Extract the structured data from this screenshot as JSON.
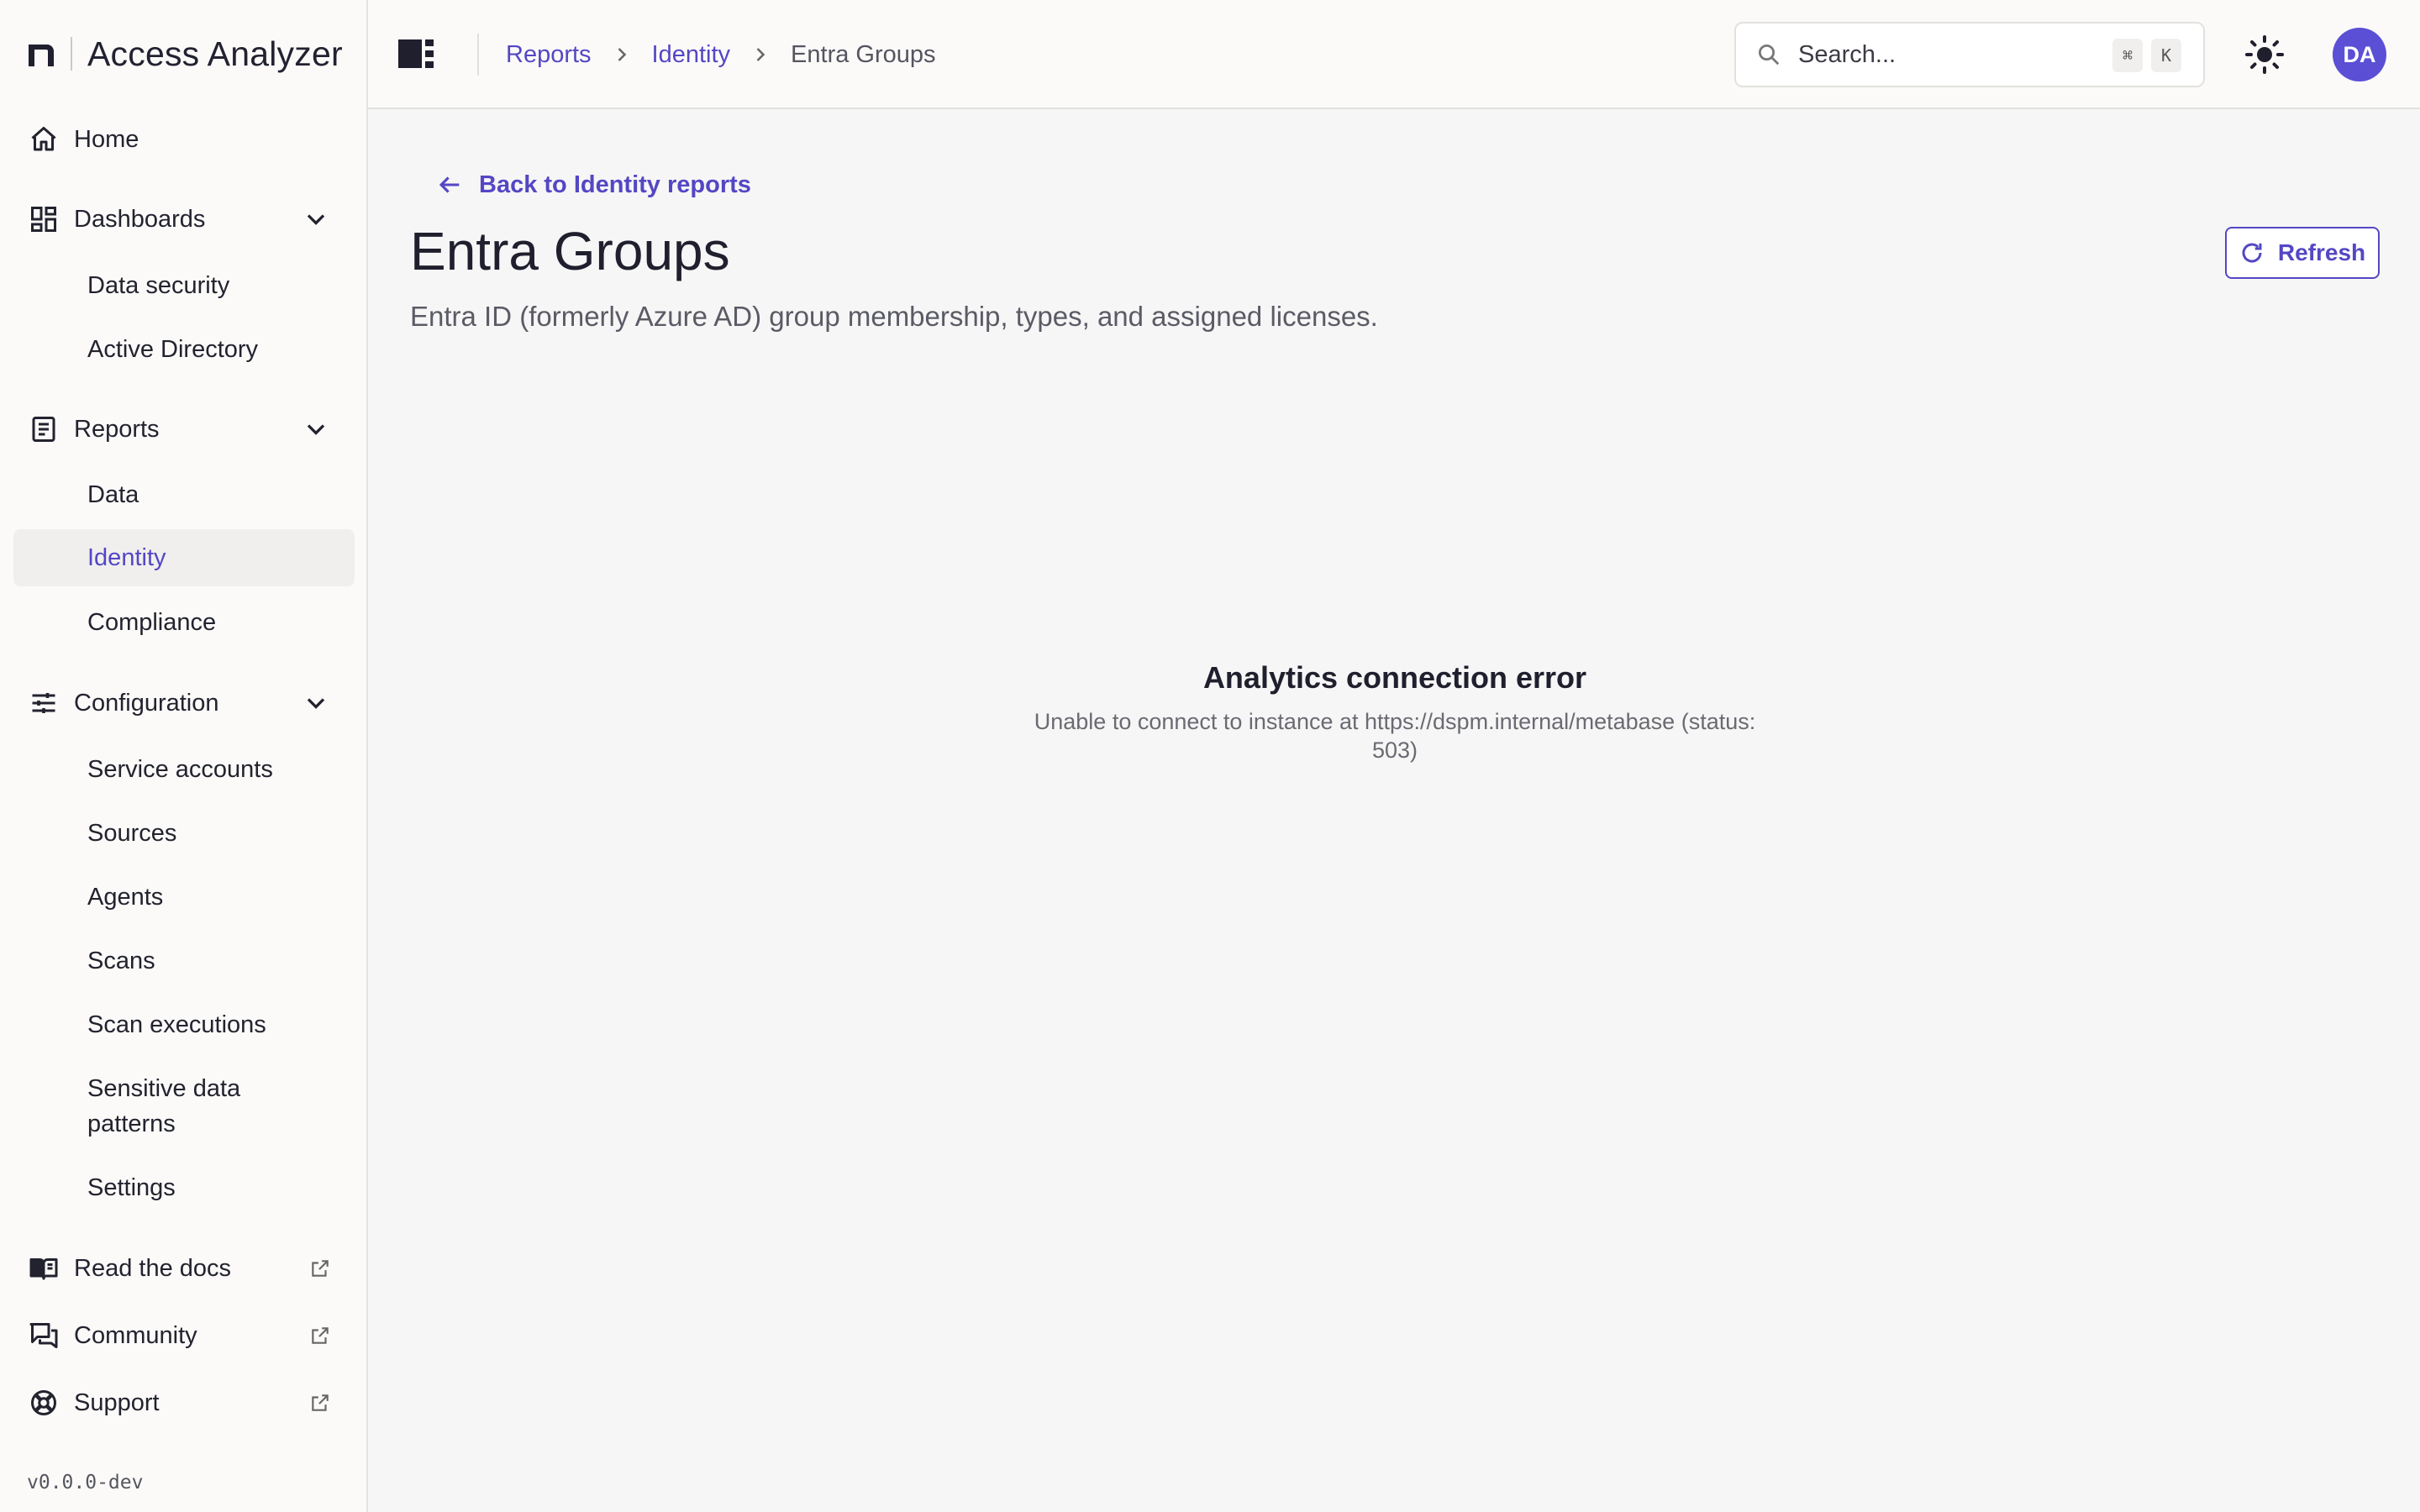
{
  "app": {
    "name": "Access Analyzer",
    "version": "v0.0.0-dev"
  },
  "sidebar": {
    "home": "Home",
    "dashboards": {
      "label": "Dashboards",
      "items": [
        "Data security",
        "Active Directory"
      ]
    },
    "reports": {
      "label": "Reports",
      "items": [
        "Data",
        "Identity",
        "Compliance"
      ],
      "active": "Identity"
    },
    "configuration": {
      "label": "Configuration",
      "items": [
        "Service accounts",
        "Sources",
        "Agents",
        "Scans",
        "Scan executions",
        "Sensitive data patterns",
        "Settings"
      ]
    },
    "external": {
      "docs": "Read the docs",
      "community": "Community",
      "support": "Support"
    }
  },
  "header": {
    "breadcrumb": [
      "Reports",
      "Identity",
      "Entra Groups"
    ],
    "search_placeholder": "Search...",
    "shortcut_keys": [
      "⌘",
      "K"
    ],
    "avatar_initials": "DA"
  },
  "main": {
    "back_label": "Back to Identity reports",
    "title": "Entra Groups",
    "description": "Entra ID (formerly Azure AD) group membership, types, and assigned licenses.",
    "refresh_label": "Refresh",
    "error": {
      "title": "Analytics connection error",
      "message": "Unable to connect to instance at https://dspm.internal/metabase (status: 503)"
    }
  },
  "colors": {
    "accent": "#5447c4",
    "avatar_bg": "#5b4fd6",
    "sidebar_bg": "#fbfaf9",
    "content_bg": "#f6f6f6"
  },
  "icons": {
    "brand": "brand-logo-icon",
    "home": "home-icon",
    "dashboards": "dashboard-grid-icon",
    "reports": "document-lines-icon",
    "configuration": "sliders-icon",
    "docs": "open-book-icon",
    "community": "chat-bubbles-icon",
    "support": "lifebuoy-icon",
    "external": "external-link-icon",
    "search": "search-icon",
    "theme": "sun-icon",
    "back": "arrow-left-icon",
    "refresh": "refresh-icon",
    "sidebar_toggle": "sidebar-toggle-icon"
  }
}
